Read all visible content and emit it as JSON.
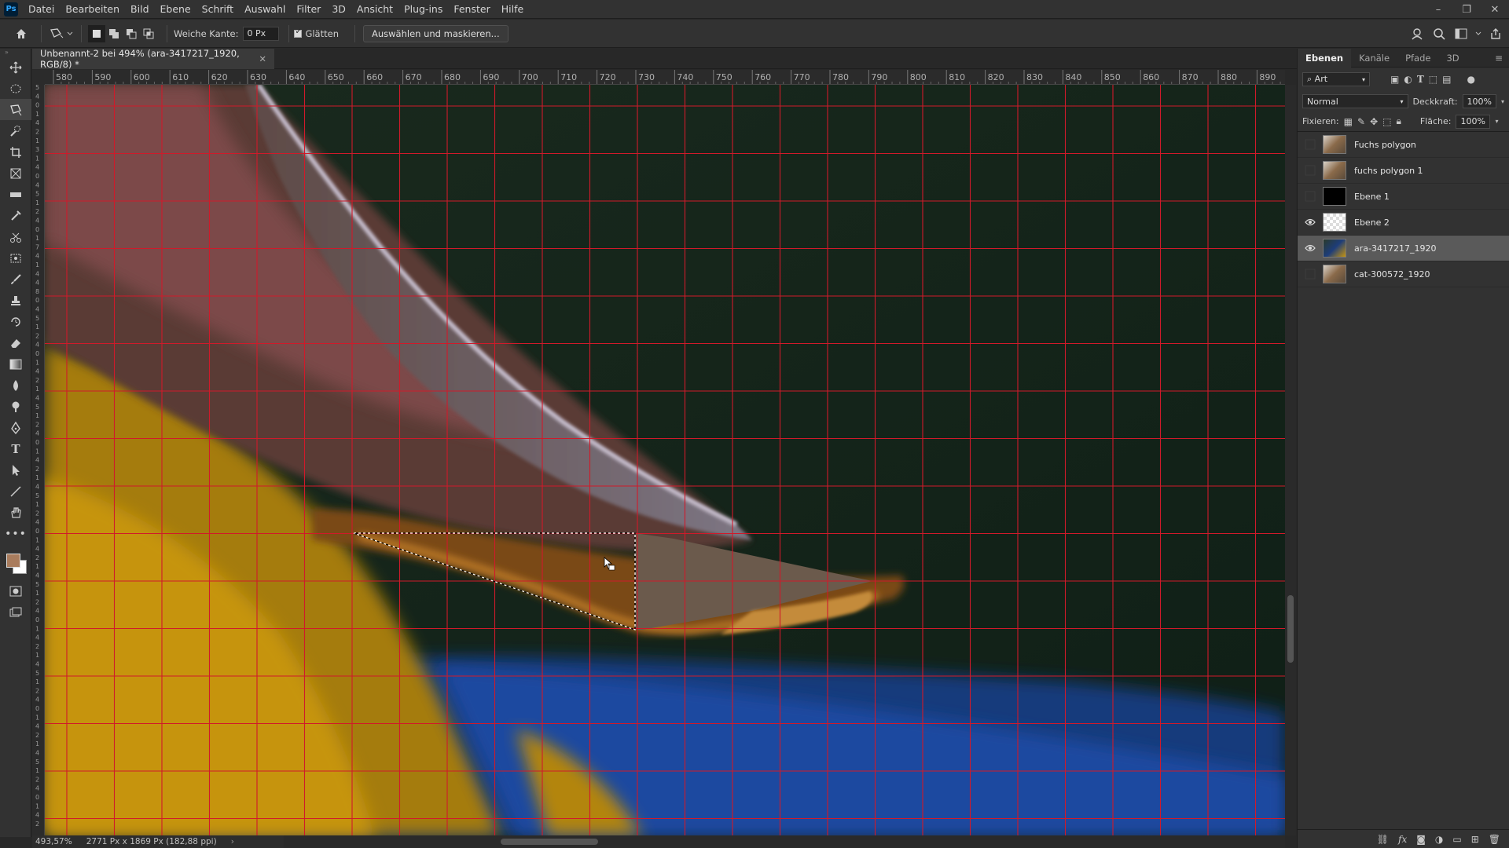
{
  "app": {
    "logo": "Ps",
    "menu": [
      "Datei",
      "Bearbeiten",
      "Bild",
      "Ebene",
      "Schrift",
      "Auswahl",
      "Filter",
      "3D",
      "Ansicht",
      "Plug-ins",
      "Fenster",
      "Hilfe"
    ]
  },
  "options": {
    "feather_label": "Weiche Kante:",
    "feather_value": "0 Px",
    "antialias_label": "Glätten",
    "select_mask_button": "Auswählen und maskieren..."
  },
  "document": {
    "tab_title": "Unbenannt-2 bei 494% (ara-3417217_1920, RGB/8) *",
    "zoom": "493,57%",
    "dimensions": "2771 Px x 1869 Px (182,88 ppi)"
  },
  "ruler_top": [
    "580",
    "590",
    "600",
    "610",
    "620",
    "630",
    "640",
    "650",
    "660",
    "670",
    "680",
    "690",
    "700",
    "710",
    "720",
    "730",
    "740",
    "750",
    "760",
    "770",
    "780",
    "790",
    "800",
    "810",
    "820",
    "830",
    "840",
    "850",
    "860",
    "870",
    "880",
    "890"
  ],
  "ruler_left": [
    "5",
    "4",
    "0",
    "1",
    "4",
    "2",
    "1",
    "3",
    "1",
    "4",
    "0",
    "4",
    "5",
    "1",
    "2",
    "4",
    "0",
    "1",
    "7",
    "4",
    "1",
    "4",
    "4",
    "8",
    "0",
    "4",
    "5",
    "1",
    "2",
    "4",
    "0",
    "1",
    "4",
    "2",
    "1",
    "4",
    "5",
    "1",
    "2",
    "4",
    "0",
    "1",
    "4",
    "2",
    "1",
    "4",
    "5",
    "1",
    "2",
    "4",
    "0",
    "1",
    "4",
    "2",
    "1",
    "4",
    "5",
    "1",
    "2",
    "4",
    "0",
    "1",
    "4",
    "2",
    "1",
    "4",
    "5",
    "1",
    "2",
    "4",
    "0",
    "1",
    "4",
    "2",
    "1",
    "4",
    "5",
    "1",
    "2",
    "4",
    "0",
    "1",
    "4",
    "2"
  ],
  "layers_panel": {
    "tabs": [
      "Ebenen",
      "Kanäle",
      "Pfade",
      "3D"
    ],
    "filter_kind": "Art",
    "blend_mode": "Normal",
    "opacity_label": "Deckkraft:",
    "opacity_value": "100%",
    "lock_label": "Fixieren:",
    "fill_label": "Fläche:",
    "fill_value": "100%",
    "layers": [
      {
        "name": "Fuchs polygon",
        "visible": false,
        "selected": false,
        "thumb": "photo"
      },
      {
        "name": "fuchs polygon 1",
        "visible": false,
        "selected": false,
        "thumb": "photo"
      },
      {
        "name": "Ebene 1",
        "visible": false,
        "selected": false,
        "thumb": "black"
      },
      {
        "name": "Ebene 2",
        "visible": true,
        "selected": false,
        "thumb": "transparent"
      },
      {
        "name": "ara-3417217_1920",
        "visible": true,
        "selected": true,
        "thumb": "parrot"
      },
      {
        "name": "cat-300572_1920",
        "visible": false,
        "selected": false,
        "thumb": "photo"
      }
    ]
  },
  "colors": {
    "foreground": "#a97c5d",
    "background": "#ffffff",
    "grid": "#d01a2a",
    "fill_polygon": "#6b5a4c"
  }
}
